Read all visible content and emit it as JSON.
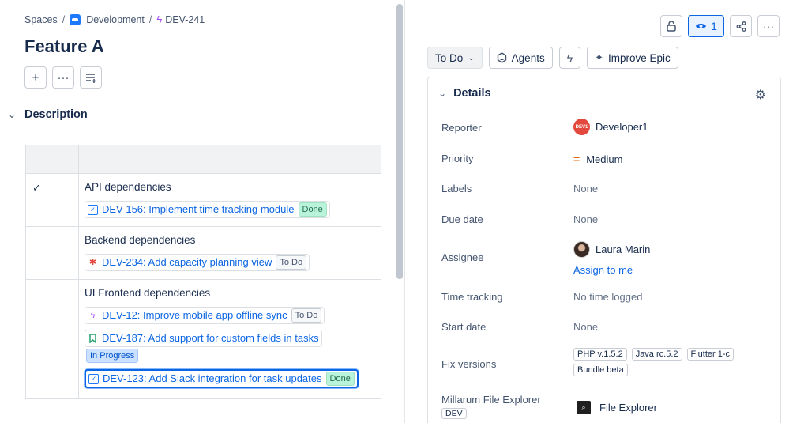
{
  "breadcrumb": {
    "spaces": "Spaces",
    "project": "Development",
    "issue_key": "DEV-241"
  },
  "page": {
    "title": "Feature A"
  },
  "description": {
    "header": "Description",
    "rows": [
      {
        "checked": true,
        "title": "API dependencies",
        "issues": [
          {
            "key_summary": "DEV-156: Implement time tracking module",
            "status": "Done",
            "type": "task"
          }
        ]
      },
      {
        "checked": false,
        "title": "Backend dependencies",
        "issues": [
          {
            "key_summary": "DEV-234: Add capacity planning view",
            "status": "To Do",
            "type": "bug"
          }
        ]
      },
      {
        "checked": false,
        "title": "UI Frontend dependencies",
        "issues": [
          {
            "key_summary": "DEV-12: Improve mobile app offline sync",
            "status": "To Do",
            "type": "epic"
          },
          {
            "key_summary": "DEV-187: Add support for custom fields in tasks",
            "status": "In Progress",
            "type": "story"
          },
          {
            "key_summary": "DEV-123: Add Slack integration for task updates",
            "status": "Done",
            "type": "task"
          }
        ]
      }
    ]
  },
  "top_actions": {
    "watch_count": "1"
  },
  "status_bar": {
    "status": "To Do",
    "agents": "Agents",
    "improve": "Improve Epic"
  },
  "details": {
    "header": "Details",
    "reporter_label": "Reporter",
    "reporter_value": "Developer1",
    "reporter_avatar_text": "DEV1",
    "priority_label": "Priority",
    "priority_value": "Medium",
    "labels_label": "Labels",
    "labels_value": "None",
    "due_label": "Due date",
    "due_value": "None",
    "assignee_label": "Assignee",
    "assignee_value": "Laura Marin",
    "assign_to_me": "Assign to me",
    "time_label": "Time tracking",
    "time_value": "No time logged",
    "start_label": "Start date",
    "start_value": "None",
    "fix_label": "Fix versions",
    "fix_versions": [
      "PHP v.1.5.2",
      "Java rc.5.2",
      "Flutter 1-c",
      "Bundle beta"
    ],
    "explorer_label": "Millarum File Explorer",
    "explorer_tag": "DEV",
    "explorer_value": "File Explorer"
  },
  "colors": {
    "link": "#0c66e4",
    "done": "#baf3db",
    "in_progress": "#cce0ff",
    "priority_medium": "#e56910"
  }
}
